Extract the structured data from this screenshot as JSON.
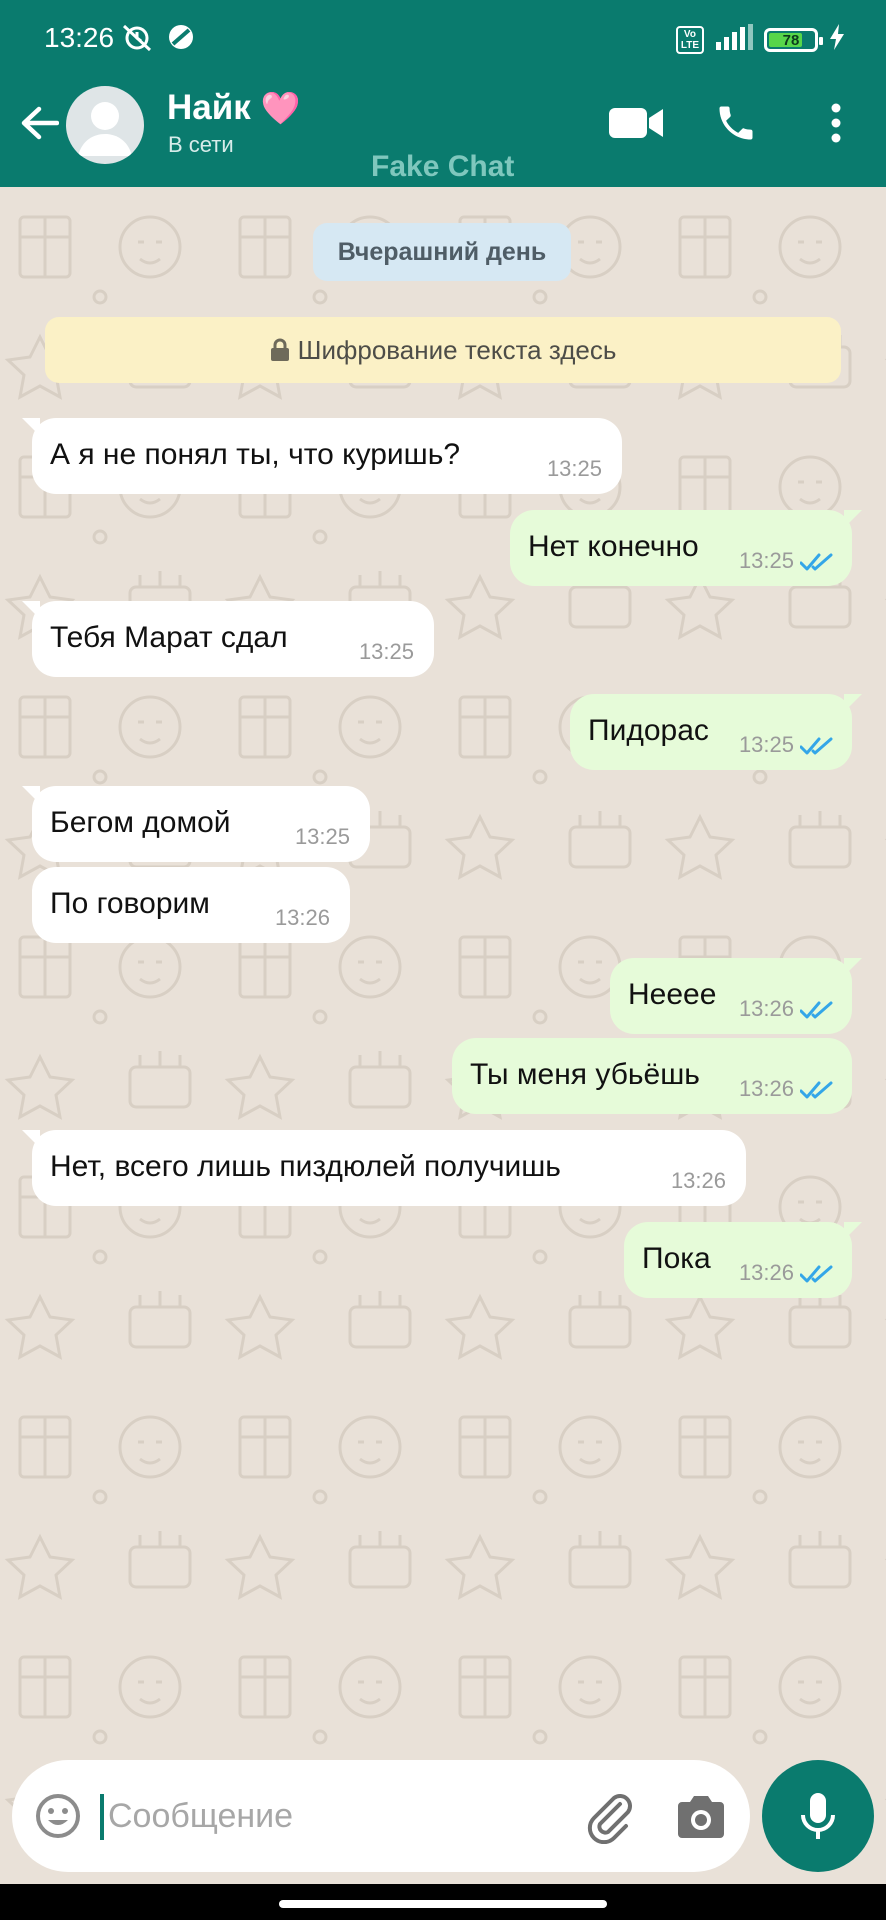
{
  "status_bar": {
    "time": "13:26",
    "volte_label": "Vo LTE",
    "battery_percent": "78",
    "battery_level": 0.78
  },
  "header": {
    "contact_name": "Найк",
    "name_emoji": "🩷",
    "presence": "В сети",
    "watermark": "Fake Chat",
    "icons": [
      "back-arrow-icon",
      "video-call-icon",
      "phone-icon",
      "more-vert-icon"
    ]
  },
  "chat": {
    "date_label": "Вчерашний день",
    "encryption_notice": "Шифрование текста здесь",
    "messages": [
      {
        "dir": "in",
        "text": "А я не понял ты, что куришь?",
        "time": "13:25"
      },
      {
        "dir": "out",
        "text": "Нет конечно",
        "time": "13:25",
        "status": "read"
      },
      {
        "dir": "in",
        "text": "Тебя Марат сдал",
        "time": "13:25"
      },
      {
        "dir": "out",
        "text": "Пидорас",
        "time": "13:25",
        "status": "read"
      },
      {
        "dir": "in",
        "text": "Бегом домой",
        "time": "13:25"
      },
      {
        "dir": "in",
        "text": "По говорим",
        "time": "13:26"
      },
      {
        "dir": "out",
        "text": "Неееe",
        "time": "13:26",
        "status": "read"
      },
      {
        "dir": "out",
        "text": "Ты меня убьёшь",
        "time": "13:26",
        "status": "read"
      },
      {
        "dir": "in",
        "text": "Нет, всего лишь пиздюлей получишь",
        "time": "13:26"
      },
      {
        "dir": "out",
        "text": "Пока",
        "time": "13:26",
        "status": "read"
      }
    ]
  },
  "composer": {
    "placeholder": "Сообщение",
    "value": ""
  },
  "colors": {
    "header": "#0a7b6e",
    "chat_bg": "#e9e1d8",
    "bubble_in": "#ffffff",
    "bubble_out": "#e6fbd9",
    "read_ticks": "#34a6e8",
    "date_chip": "#d6e8f3",
    "notice_bg": "#fbf1c6"
  }
}
